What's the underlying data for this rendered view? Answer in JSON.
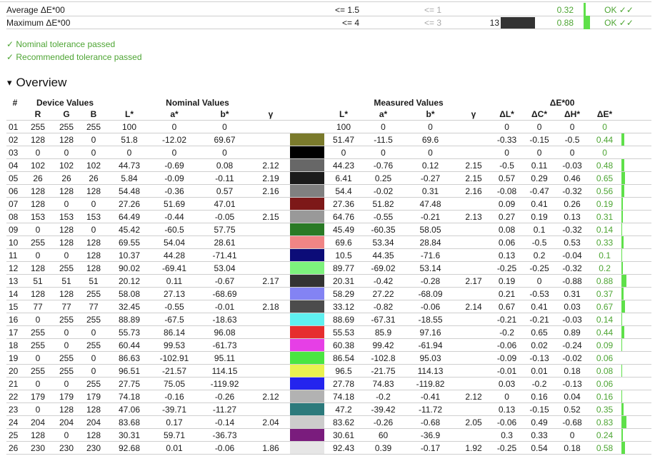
{
  "summary": [
    {
      "label": "Average ΔE*00",
      "nominal": "<= 1.5",
      "recommended": "<= 1",
      "count": "",
      "value": "0.32",
      "status": "OK ✓✓",
      "bar": 0.2,
      "swatch": false
    },
    {
      "label": "Maximum ΔE*00",
      "nominal": "<= 4",
      "recommended": "<= 3",
      "count": "13",
      "value": "0.88",
      "status": "OK ✓✓",
      "bar": 0.55,
      "swatch": true
    }
  ],
  "checks": {
    "nominal": "✓ Nominal tolerance passed",
    "recommended": "✓ Recommended tolerance passed"
  },
  "overview": {
    "arrow": "▾",
    "title": "Overview"
  },
  "table": {
    "group_headers": {
      "num": "#",
      "device": "Device Values",
      "nominal": "Nominal Values",
      "measured": "Measured Values",
      "de": "ΔE*00"
    },
    "columns": {
      "R": "R",
      "G": "G",
      "B": "B",
      "nL": "L*",
      "na": "a*",
      "nb": "b*",
      "ng": "γ",
      "mL": "L*",
      "ma": "a*",
      "mb": "b*",
      "mg": "γ",
      "dL": "ΔL*",
      "dC": "ΔC*",
      "dH": "ΔH*",
      "dE": "ΔE*"
    },
    "rows": [
      {
        "n": "01",
        "R": "255",
        "G": "255",
        "B": "255",
        "nL": "100",
        "na": "0",
        "nb": "0",
        "ng": "",
        "color": "#ffffff",
        "mL": "100",
        "ma": "0",
        "mb": "0",
        "mg": "",
        "dL": "0",
        "dC": "0",
        "dH": "0",
        "dE": "0",
        "bar": 0
      },
      {
        "n": "02",
        "R": "128",
        "G": "128",
        "B": "0",
        "nL": "51.8",
        "na": "-12.02",
        "nb": "69.67",
        "ng": "",
        "color": "#7a7a2c",
        "mL": "51.47",
        "ma": "-11.5",
        "mb": "69.6",
        "mg": "",
        "dL": "-0.33",
        "dC": "-0.15",
        "dH": "-0.5",
        "dE": "0.44",
        "bar": 0.44
      },
      {
        "n": "03",
        "R": "0",
        "G": "0",
        "B": "0",
        "nL": "0",
        "na": "0",
        "nb": "0",
        "ng": "",
        "color": "#000000",
        "mL": "0",
        "ma": "0",
        "mb": "0",
        "mg": "",
        "dL": "0",
        "dC": "0",
        "dH": "0",
        "dE": "0",
        "bar": 0
      },
      {
        "n": "04",
        "R": "102",
        "G": "102",
        "B": "102",
        "nL": "44.73",
        "na": "-0.69",
        "nb": "0.08",
        "ng": "2.12",
        "color": "#676767",
        "mL": "44.23",
        "ma": "-0.76",
        "mb": "0.12",
        "mg": "2.15",
        "dL": "-0.5",
        "dC": "0.11",
        "dH": "-0.03",
        "dE": "0.48",
        "bar": 0.48
      },
      {
        "n": "05",
        "R": "26",
        "G": "26",
        "B": "26",
        "nL": "5.84",
        "na": "-0.09",
        "nb": "-0.11",
        "ng": "2.19",
        "color": "#1b1b1b",
        "mL": "6.41",
        "ma": "0.25",
        "mb": "-0.27",
        "mg": "2.15",
        "dL": "0.57",
        "dC": "0.29",
        "dH": "0.46",
        "dE": "0.65",
        "bar": 0.65
      },
      {
        "n": "06",
        "R": "128",
        "G": "128",
        "B": "128",
        "nL": "54.48",
        "na": "-0.36",
        "nb": "0.57",
        "ng": "2.16",
        "color": "#808080",
        "mL": "54.4",
        "ma": "-0.02",
        "mb": "0.31",
        "mg": "2.16",
        "dL": "-0.08",
        "dC": "-0.47",
        "dH": "-0.32",
        "dE": "0.56",
        "bar": 0.56
      },
      {
        "n": "07",
        "R": "128",
        "G": "0",
        "B": "0",
        "nL": "27.26",
        "na": "51.69",
        "nb": "47.01",
        "ng": "",
        "color": "#7d1818",
        "mL": "27.36",
        "ma": "51.82",
        "mb": "47.48",
        "mg": "",
        "dL": "0.09",
        "dC": "0.41",
        "dH": "0.26",
        "dE": "0.19",
        "bar": 0.19
      },
      {
        "n": "08",
        "R": "153",
        "G": "153",
        "B": "153",
        "nL": "64.49",
        "na": "-0.44",
        "nb": "-0.05",
        "ng": "2.15",
        "color": "#999999",
        "mL": "64.76",
        "ma": "-0.55",
        "mb": "-0.21",
        "mg": "2.13",
        "dL": "0.27",
        "dC": "0.19",
        "dH": "0.13",
        "dE": "0.31",
        "bar": 0.31
      },
      {
        "n": "09",
        "R": "0",
        "G": "128",
        "B": "0",
        "nL": "45.42",
        "na": "-60.5",
        "nb": "57.75",
        "ng": "",
        "color": "#2a7a25",
        "mL": "45.49",
        "ma": "-60.35",
        "mb": "58.05",
        "mg": "",
        "dL": "0.08",
        "dC": "0.1",
        "dH": "-0.32",
        "dE": "0.14",
        "bar": 0.14
      },
      {
        "n": "10",
        "R": "255",
        "G": "128",
        "B": "128",
        "nL": "69.55",
        "na": "54.04",
        "nb": "28.61",
        "ng": "",
        "color": "#f08585",
        "mL": "69.6",
        "ma": "53.34",
        "mb": "28.84",
        "mg": "",
        "dL": "0.06",
        "dC": "-0.5",
        "dH": "0.53",
        "dE": "0.33",
        "bar": 0.33
      },
      {
        "n": "11",
        "R": "0",
        "G": "0",
        "B": "128",
        "nL": "10.37",
        "na": "44.28",
        "nb": "-71.41",
        "ng": "",
        "color": "#0c0c78",
        "mL": "10.5",
        "ma": "44.35",
        "mb": "-71.6",
        "mg": "",
        "dL": "0.13",
        "dC": "0.2",
        "dH": "-0.04",
        "dE": "0.1",
        "bar": 0.1
      },
      {
        "n": "12",
        "R": "128",
        "G": "255",
        "B": "128",
        "nL": "90.02",
        "na": "-69.41",
        "nb": "53.04",
        "ng": "",
        "color": "#7df27d",
        "mL": "89.77",
        "ma": "-69.02",
        "mb": "53.14",
        "mg": "",
        "dL": "-0.25",
        "dC": "-0.25",
        "dH": "-0.32",
        "dE": "0.2",
        "bar": 0.2
      },
      {
        "n": "13",
        "R": "51",
        "G": "51",
        "B": "51",
        "nL": "20.12",
        "na": "0.11",
        "nb": "-0.67",
        "ng": "2.17",
        "color": "#333333",
        "mL": "20.31",
        "ma": "-0.42",
        "mb": "-0.28",
        "mg": "2.17",
        "dL": "0.19",
        "dC": "0",
        "dH": "-0.88",
        "dE": "0.88",
        "bar": 0.88
      },
      {
        "n": "14",
        "R": "128",
        "G": "128",
        "B": "255",
        "nL": "58.08",
        "na": "27.13",
        "nb": "-68.69",
        "ng": "",
        "color": "#8383f3",
        "mL": "58.29",
        "ma": "27.22",
        "mb": "-68.09",
        "mg": "",
        "dL": "0.21",
        "dC": "-0.53",
        "dH": "0.31",
        "dE": "0.37",
        "bar": 0.37
      },
      {
        "n": "15",
        "R": "77",
        "G": "77",
        "B": "77",
        "nL": "32.45",
        "na": "-0.55",
        "nb": "-0.01",
        "ng": "2.18",
        "color": "#4c4c4c",
        "mL": "33.12",
        "ma": "-0.82",
        "mb": "-0.06",
        "mg": "2.14",
        "dL": "0.67",
        "dC": "0.41",
        "dH": "0.03",
        "dE": "0.67",
        "bar": 0.67
      },
      {
        "n": "16",
        "R": "0",
        "G": "255",
        "B": "255",
        "nL": "88.89",
        "na": "-67.5",
        "nb": "-18.63",
        "ng": "",
        "color": "#5ff0f0",
        "mL": "88.69",
        "ma": "-67.31",
        "mb": "-18.55",
        "mg": "",
        "dL": "-0.21",
        "dC": "-0.21",
        "dH": "-0.03",
        "dE": "0.14",
        "bar": 0.14
      },
      {
        "n": "17",
        "R": "255",
        "G": "0",
        "B": "0",
        "nL": "55.73",
        "na": "86.14",
        "nb": "96.08",
        "ng": "",
        "color": "#e62e2e",
        "mL": "55.53",
        "ma": "85.9",
        "mb": "97.16",
        "mg": "",
        "dL": "-0.2",
        "dC": "0.65",
        "dH": "0.89",
        "dE": "0.44",
        "bar": 0.44
      },
      {
        "n": "18",
        "R": "255",
        "G": "0",
        "B": "255",
        "nL": "60.44",
        "na": "99.53",
        "nb": "-61.73",
        "ng": "",
        "color": "#e63fe6",
        "mL": "60.38",
        "ma": "99.42",
        "mb": "-61.94",
        "mg": "",
        "dL": "-0.06",
        "dC": "0.02",
        "dH": "-0.24",
        "dE": "0.09",
        "bar": 0.09
      },
      {
        "n": "19",
        "R": "0",
        "G": "255",
        "B": "0",
        "nL": "86.63",
        "na": "-102.91",
        "nb": "95.11",
        "ng": "",
        "color": "#4ae642",
        "mL": "86.54",
        "ma": "-102.8",
        "mb": "95.03",
        "mg": "",
        "dL": "-0.09",
        "dC": "-0.13",
        "dH": "-0.02",
        "dE": "0.06",
        "bar": 0.06
      },
      {
        "n": "20",
        "R": "255",
        "G": "255",
        "B": "0",
        "nL": "96.51",
        "na": "-21.57",
        "nb": "114.15",
        "ng": "",
        "color": "#eaf250",
        "mL": "96.5",
        "ma": "-21.75",
        "mb": "114.13",
        "mg": "",
        "dL": "-0.01",
        "dC": "0.01",
        "dH": "0.18",
        "dE": "0.08",
        "bar": 0.08
      },
      {
        "n": "21",
        "R": "0",
        "G": "0",
        "B": "255",
        "nL": "27.75",
        "na": "75.05",
        "nb": "-119.92",
        "ng": "",
        "color": "#2424ee",
        "mL": "27.78",
        "ma": "74.83",
        "mb": "-119.82",
        "mg": "",
        "dL": "0.03",
        "dC": "-0.2",
        "dH": "-0.13",
        "dE": "0.06",
        "bar": 0.06
      },
      {
        "n": "22",
        "R": "179",
        "G": "179",
        "B": "179",
        "nL": "74.18",
        "na": "-0.16",
        "nb": "-0.26",
        "ng": "2.12",
        "color": "#b2b2b2",
        "mL": "74.18",
        "ma": "-0.2",
        "mb": "-0.41",
        "mg": "2.12",
        "dL": "0",
        "dC": "0.16",
        "dH": "0.04",
        "dE": "0.16",
        "bar": 0.16
      },
      {
        "n": "23",
        "R": "0",
        "G": "128",
        "B": "128",
        "nL": "47.06",
        "na": "-39.71",
        "nb": "-11.27",
        "ng": "",
        "color": "#2c7a7c",
        "mL": "47.2",
        "ma": "-39.42",
        "mb": "-11.72",
        "mg": "",
        "dL": "0.13",
        "dC": "-0.15",
        "dH": "0.52",
        "dE": "0.35",
        "bar": 0.35
      },
      {
        "n": "24",
        "R": "204",
        "G": "204",
        "B": "204",
        "nL": "83.68",
        "na": "0.17",
        "nb": "-0.14",
        "ng": "2.04",
        "color": "#cccccc",
        "mL": "83.62",
        "ma": "-0.26",
        "mb": "-0.68",
        "mg": "2.05",
        "dL": "-0.06",
        "dC": "0.49",
        "dH": "-0.68",
        "dE": "0.83",
        "bar": 0.83
      },
      {
        "n": "25",
        "R": "128",
        "G": "0",
        "B": "128",
        "nL": "30.31",
        "na": "59.71",
        "nb": "-36.73",
        "ng": "",
        "color": "#7a1c7d",
        "mL": "30.61",
        "ma": "60",
        "mb": "-36.9",
        "mg": "",
        "dL": "0.3",
        "dC": "0.33",
        "dH": "0",
        "dE": "0.24",
        "bar": 0.24
      },
      {
        "n": "26",
        "R": "230",
        "G": "230",
        "B": "230",
        "nL": "92.68",
        "na": "0.01",
        "nb": "-0.06",
        "ng": "1.86",
        "color": "#e6e6e6",
        "mL": "92.43",
        "ma": "0.39",
        "mb": "-0.17",
        "mg": "1.92",
        "dL": "-0.25",
        "dC": "0.54",
        "dH": "0.18",
        "dE": "0.58",
        "bar": 0.58
      }
    ]
  },
  "colors": {
    "ok": "#4ea534",
    "bar": "#5fe04a",
    "grid": "#cfcfcf"
  }
}
